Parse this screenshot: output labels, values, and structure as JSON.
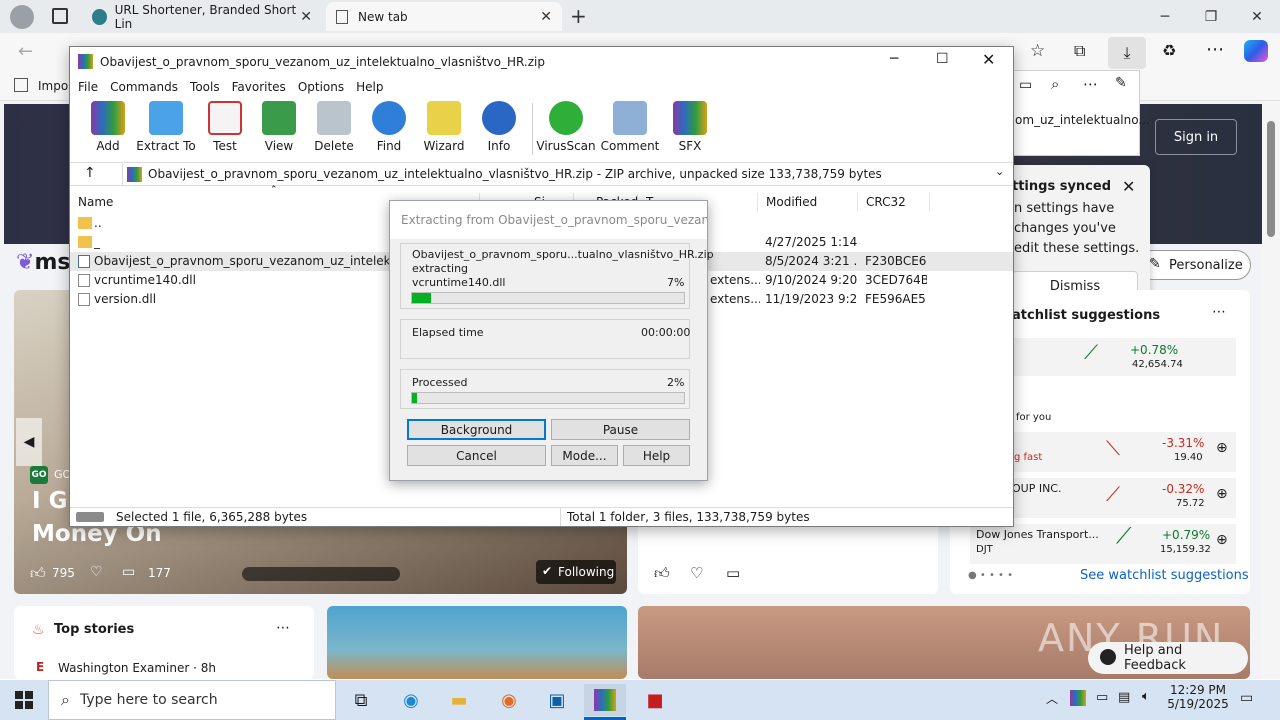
{
  "browser": {
    "tabs": [
      {
        "label": "URL Shortener, Branded Short Lin",
        "active": false
      },
      {
        "label": "New tab",
        "active": true
      }
    ],
    "favorites_label": "Impor",
    "side_panel_item": "om_uz_intelektualno...",
    "colors": {
      "chrome": "#e8ebee",
      "toolbar": "#f7f7f7"
    }
  },
  "msn": {
    "brand_fragment": "ms",
    "signin_label": "Sign in",
    "personalize_label": "Personalize",
    "notification": {
      "title": "ttings synced",
      "body_lines": [
        "n settings have",
        "changes you've",
        "edit these settings."
      ],
      "dismiss_label": "Dismiss"
    },
    "hero": {
      "badge": "GO",
      "badge_text": "GO",
      "headline_1": "I Gr",
      "headline_2": "Money On",
      "likes": "795",
      "comments": "177",
      "following_label": "Following"
    },
    "watchlist": {
      "header": "atchlist suggestions",
      "rows": [
        {
          "name": "",
          "symbol": "",
          "change": "+0.78%",
          "price": "42,654.74",
          "trend": "up"
        },
        {
          "name": "",
          "symbol": "g fast",
          "change": "-3.31%",
          "price": "19.40",
          "trend": "down"
        },
        {
          "name": "OUP INC.",
          "symbol": "",
          "change": "-0.32%",
          "price": "75.72",
          "trend": "down"
        },
        {
          "name": "Dow Jones Transport...",
          "symbol": "DJT",
          "change": "+0.79%",
          "price": "15,159.32",
          "trend": "up"
        }
      ],
      "for_you_label": "for you",
      "see_more_label": "See watchlist suggestions"
    },
    "top_stories": {
      "title": "Top stories",
      "source": "Washington Examiner · 8h"
    },
    "help_feedback_label": "Help and Feedback",
    "watermark": "ANY RUN"
  },
  "winrar": {
    "title": "Obavijest_o_pravnom_sporu_vezanom_uz_intelektualno_vlasništvo_HR.zip",
    "menu": [
      "File",
      "Commands",
      "Tools",
      "Favorites",
      "Options",
      "Help"
    ],
    "toolbar": [
      "Add",
      "Extract To",
      "Test",
      "View",
      "Delete",
      "Find",
      "Wizard",
      "Info",
      "VirusScan",
      "Comment",
      "SFX"
    ],
    "path_text": "Obavijest_o_pravnom_sporu_vezanom_uz_intelektualno_vlasništvo_HR.zip - ZIP archive, unpacked size 133,738,759 bytes",
    "columns": [
      "Name",
      "Si",
      "Packed",
      "T",
      "Modified",
      "CRC32"
    ],
    "files": [
      {
        "name": "..",
        "type": "",
        "modified": "",
        "crc": "",
        "icon": "folder-icon"
      },
      {
        "name": "_",
        "type": "",
        "modified": "4/27/2025 1:14 ...",
        "crc": "",
        "icon": "folder-icon"
      },
      {
        "name": "Obavijest_o_pravnom_sporu_vezanom_uz_intelektualno_",
        "type": "",
        "modified": "8/5/2024 3:21 ...",
        "crc": "F230BCE6",
        "icon": "pdf-file-icon",
        "selected": true
      },
      {
        "name": "vcruntime140.dll",
        "type": "extens...",
        "modified": "9/10/2024 9:20 ...",
        "crc": "3CED764B",
        "icon": "dll-file-icon"
      },
      {
        "name": "version.dll",
        "type": "extens...",
        "modified": "11/19/2023 9:2...",
        "crc": "FE596AE5",
        "icon": "dll-file-icon"
      }
    ],
    "status_left": "Selected 1 file, 6,365,288 bytes",
    "status_right": "Total 1 folder, 3 files, 133,738,759 bytes"
  },
  "extract_dialog": {
    "title": "Extracting from Obavijest_o_pravnom_sporu_vezanom...",
    "archive_name": "Obavijest_o_pravnom_sporu...tualno_vlasništvo_HR.zip",
    "action": "extracting",
    "current_file": "vcruntime140.dll",
    "file_percent_text": "7%",
    "file_progress": 0.07,
    "elapsed_label": "Elapsed time",
    "elapsed_value": "00:00:00",
    "processed_label": "Processed",
    "processed_percent_text": "2%",
    "processed_progress": 0.02,
    "buttons": {
      "background": "Background",
      "pause": "Pause",
      "cancel": "Cancel",
      "mode": "Mode...",
      "help": "Help"
    }
  },
  "taskbar": {
    "search_placeholder": "Type here to search",
    "time": "12:29 PM",
    "date": "5/19/2025"
  }
}
